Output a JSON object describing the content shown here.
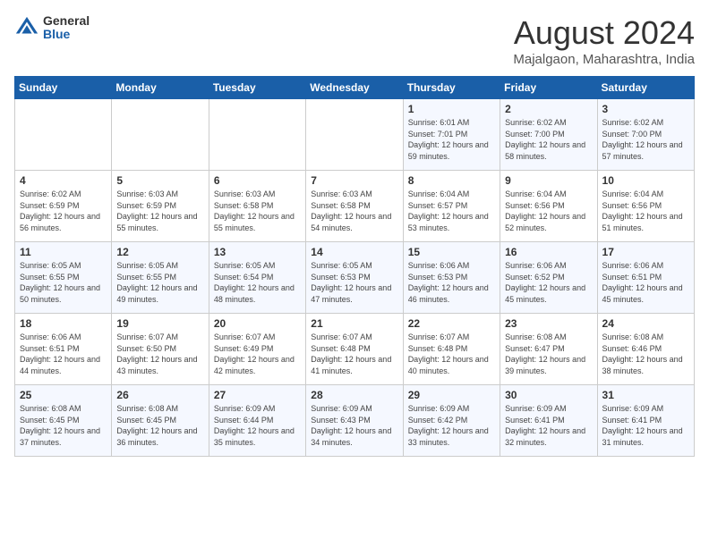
{
  "header": {
    "logo_general": "General",
    "logo_blue": "Blue",
    "title": "August 2024",
    "location": "Majalgaon, Maharashtra, India"
  },
  "days_of_week": [
    "Sunday",
    "Monday",
    "Tuesday",
    "Wednesday",
    "Thursday",
    "Friday",
    "Saturday"
  ],
  "weeks": [
    [
      {
        "num": "",
        "info": ""
      },
      {
        "num": "",
        "info": ""
      },
      {
        "num": "",
        "info": ""
      },
      {
        "num": "",
        "info": ""
      },
      {
        "num": "1",
        "sunrise": "Sunrise: 6:01 AM",
        "sunset": "Sunset: 7:01 PM",
        "daylight": "Daylight: 12 hours and 59 minutes."
      },
      {
        "num": "2",
        "sunrise": "Sunrise: 6:02 AM",
        "sunset": "Sunset: 7:00 PM",
        "daylight": "Daylight: 12 hours and 58 minutes."
      },
      {
        "num": "3",
        "sunrise": "Sunrise: 6:02 AM",
        "sunset": "Sunset: 7:00 PM",
        "daylight": "Daylight: 12 hours and 57 minutes."
      }
    ],
    [
      {
        "num": "4",
        "sunrise": "Sunrise: 6:02 AM",
        "sunset": "Sunset: 6:59 PM",
        "daylight": "Daylight: 12 hours and 56 minutes."
      },
      {
        "num": "5",
        "sunrise": "Sunrise: 6:03 AM",
        "sunset": "Sunset: 6:59 PM",
        "daylight": "Daylight: 12 hours and 55 minutes."
      },
      {
        "num": "6",
        "sunrise": "Sunrise: 6:03 AM",
        "sunset": "Sunset: 6:58 PM",
        "daylight": "Daylight: 12 hours and 55 minutes."
      },
      {
        "num": "7",
        "sunrise": "Sunrise: 6:03 AM",
        "sunset": "Sunset: 6:58 PM",
        "daylight": "Daylight: 12 hours and 54 minutes."
      },
      {
        "num": "8",
        "sunrise": "Sunrise: 6:04 AM",
        "sunset": "Sunset: 6:57 PM",
        "daylight": "Daylight: 12 hours and 53 minutes."
      },
      {
        "num": "9",
        "sunrise": "Sunrise: 6:04 AM",
        "sunset": "Sunset: 6:56 PM",
        "daylight": "Daylight: 12 hours and 52 minutes."
      },
      {
        "num": "10",
        "sunrise": "Sunrise: 6:04 AM",
        "sunset": "Sunset: 6:56 PM",
        "daylight": "Daylight: 12 hours and 51 minutes."
      }
    ],
    [
      {
        "num": "11",
        "sunrise": "Sunrise: 6:05 AM",
        "sunset": "Sunset: 6:55 PM",
        "daylight": "Daylight: 12 hours and 50 minutes."
      },
      {
        "num": "12",
        "sunrise": "Sunrise: 6:05 AM",
        "sunset": "Sunset: 6:55 PM",
        "daylight": "Daylight: 12 hours and 49 minutes."
      },
      {
        "num": "13",
        "sunrise": "Sunrise: 6:05 AM",
        "sunset": "Sunset: 6:54 PM",
        "daylight": "Daylight: 12 hours and 48 minutes."
      },
      {
        "num": "14",
        "sunrise": "Sunrise: 6:05 AM",
        "sunset": "Sunset: 6:53 PM",
        "daylight": "Daylight: 12 hours and 47 minutes."
      },
      {
        "num": "15",
        "sunrise": "Sunrise: 6:06 AM",
        "sunset": "Sunset: 6:53 PM",
        "daylight": "Daylight: 12 hours and 46 minutes."
      },
      {
        "num": "16",
        "sunrise": "Sunrise: 6:06 AM",
        "sunset": "Sunset: 6:52 PM",
        "daylight": "Daylight: 12 hours and 45 minutes."
      },
      {
        "num": "17",
        "sunrise": "Sunrise: 6:06 AM",
        "sunset": "Sunset: 6:51 PM",
        "daylight": "Daylight: 12 hours and 45 minutes."
      }
    ],
    [
      {
        "num": "18",
        "sunrise": "Sunrise: 6:06 AM",
        "sunset": "Sunset: 6:51 PM",
        "daylight": "Daylight: 12 hours and 44 minutes."
      },
      {
        "num": "19",
        "sunrise": "Sunrise: 6:07 AM",
        "sunset": "Sunset: 6:50 PM",
        "daylight": "Daylight: 12 hours and 43 minutes."
      },
      {
        "num": "20",
        "sunrise": "Sunrise: 6:07 AM",
        "sunset": "Sunset: 6:49 PM",
        "daylight": "Daylight: 12 hours and 42 minutes."
      },
      {
        "num": "21",
        "sunrise": "Sunrise: 6:07 AM",
        "sunset": "Sunset: 6:48 PM",
        "daylight": "Daylight: 12 hours and 41 minutes."
      },
      {
        "num": "22",
        "sunrise": "Sunrise: 6:07 AM",
        "sunset": "Sunset: 6:48 PM",
        "daylight": "Daylight: 12 hours and 40 minutes."
      },
      {
        "num": "23",
        "sunrise": "Sunrise: 6:08 AM",
        "sunset": "Sunset: 6:47 PM",
        "daylight": "Daylight: 12 hours and 39 minutes."
      },
      {
        "num": "24",
        "sunrise": "Sunrise: 6:08 AM",
        "sunset": "Sunset: 6:46 PM",
        "daylight": "Daylight: 12 hours and 38 minutes."
      }
    ],
    [
      {
        "num": "25",
        "sunrise": "Sunrise: 6:08 AM",
        "sunset": "Sunset: 6:45 PM",
        "daylight": "Daylight: 12 hours and 37 minutes."
      },
      {
        "num": "26",
        "sunrise": "Sunrise: 6:08 AM",
        "sunset": "Sunset: 6:45 PM",
        "daylight": "Daylight: 12 hours and 36 minutes."
      },
      {
        "num": "27",
        "sunrise": "Sunrise: 6:09 AM",
        "sunset": "Sunset: 6:44 PM",
        "daylight": "Daylight: 12 hours and 35 minutes."
      },
      {
        "num": "28",
        "sunrise": "Sunrise: 6:09 AM",
        "sunset": "Sunset: 6:43 PM",
        "daylight": "Daylight: 12 hours and 34 minutes."
      },
      {
        "num": "29",
        "sunrise": "Sunrise: 6:09 AM",
        "sunset": "Sunset: 6:42 PM",
        "daylight": "Daylight: 12 hours and 33 minutes."
      },
      {
        "num": "30",
        "sunrise": "Sunrise: 6:09 AM",
        "sunset": "Sunset: 6:41 PM",
        "daylight": "Daylight: 12 hours and 32 minutes."
      },
      {
        "num": "31",
        "sunrise": "Sunrise: 6:09 AM",
        "sunset": "Sunset: 6:41 PM",
        "daylight": "Daylight: 12 hours and 31 minutes."
      }
    ]
  ]
}
